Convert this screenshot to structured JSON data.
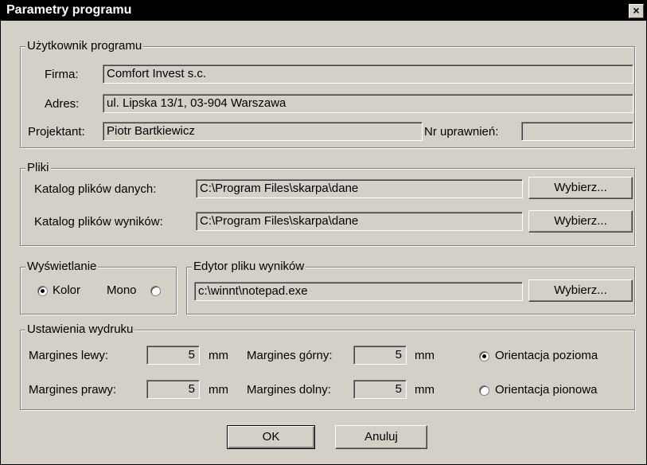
{
  "window": {
    "title": "Parametry programu",
    "close_label": "×"
  },
  "user_group": {
    "legend": "Użytkownik programu",
    "firma_label": "Firma:",
    "firma_value": "Comfort Invest s.c.",
    "adres_label": "Adres:",
    "adres_value": "ul. Lipska 13/1, 03-904 Warszawa",
    "projektant_label": "Projektant:",
    "projektant_value": "Piotr Bartkiewicz",
    "uprawnien_label": "Nr uprawnień:",
    "uprawnien_value": ""
  },
  "files_group": {
    "legend": "Pliki",
    "data_dir_label": "Katalog plików danych:",
    "data_dir_value": "C:\\Program Files\\skarpa\\dane",
    "results_dir_label": "Katalog plików wyników:",
    "results_dir_value": "C:\\Program Files\\skarpa\\dane",
    "browse_label": "Wybierz..."
  },
  "display_group": {
    "legend": "Wyświetlanie",
    "color_label": "Kolor",
    "mono_label": "Mono",
    "selected": "Kolor"
  },
  "editor_group": {
    "legend": "Edytor pliku wyników",
    "path_value": "c:\\winnt\\notepad.exe",
    "browse_label": "Wybierz..."
  },
  "print_group": {
    "legend": "Ustawienia wydruku",
    "left_label": "Margines lewy:",
    "left_value": "5",
    "right_label": "Margines prawy:",
    "right_value": "5",
    "top_label": "Margines górny:",
    "top_value": "5",
    "bottom_label": "Margines dolny:",
    "bottom_value": "5",
    "unit": "mm",
    "landscape_label": "Orientacja pozioma",
    "portrait_label": "Orientacja pionowa",
    "selected_orientation": "Orientacja pozioma"
  },
  "buttons": {
    "ok_label": "OK",
    "cancel_label": "Anuluj"
  }
}
